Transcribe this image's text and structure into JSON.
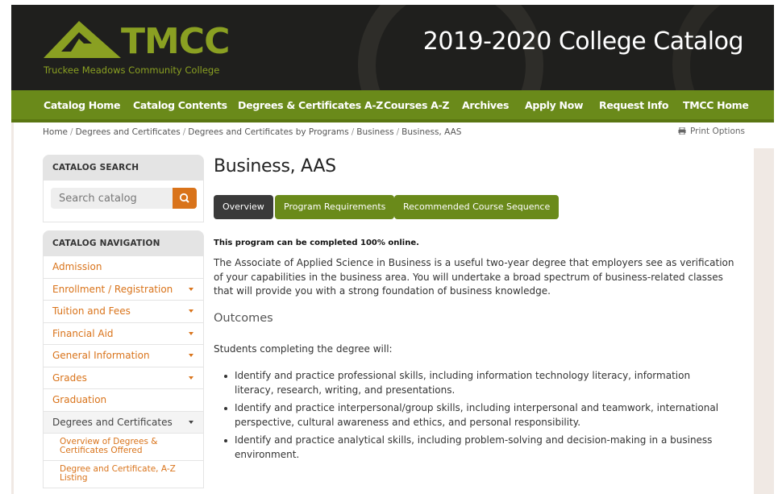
{
  "header": {
    "logo_text": "TMCC",
    "logo_subtitle": "Truckee Meadows Community College",
    "site_title": "2019-2020 College Catalog"
  },
  "nav": {
    "items": [
      {
        "label": "Catalog Home"
      },
      {
        "label": "Catalog Contents"
      },
      {
        "label": "Degrees & Certificates A-Z"
      },
      {
        "label": "Courses A-Z"
      },
      {
        "label": "Archives"
      },
      {
        "label": "Apply Now"
      },
      {
        "label": "Request Info"
      },
      {
        "label": "TMCC Home"
      }
    ]
  },
  "breadcrumb": {
    "items": [
      "Home",
      "Degrees and Certificates",
      "Degrees and Certificates by Programs",
      "Business",
      "Business, AAS"
    ],
    "separator": "/"
  },
  "print_options": "Print Options",
  "sidebar": {
    "search_title": "CATALOG SEARCH",
    "search_placeholder": "Search catalog",
    "nav_title": "CATALOG NAVIGATION",
    "items": [
      {
        "label": "Admission",
        "has_caret": false
      },
      {
        "label": "Enrollment / Registration",
        "has_caret": true
      },
      {
        "label": "Tuition and Fees",
        "has_caret": true
      },
      {
        "label": "Financial Aid",
        "has_caret": true
      },
      {
        "label": "General Information",
        "has_caret": true
      },
      {
        "label": "Grades",
        "has_caret": true
      },
      {
        "label": "Graduation",
        "has_caret": false
      },
      {
        "label": "Degrees and Certificates",
        "has_caret": true,
        "open": true
      }
    ],
    "subitems": [
      {
        "label": "Overview of Degrees & Certificates Offered"
      },
      {
        "label": "Degree and Certificate, A-Z Listing"
      }
    ]
  },
  "main": {
    "title": "Business, AAS",
    "tabs": [
      {
        "label": "Overview",
        "active": true
      },
      {
        "label": "Program Requirements",
        "active": false
      },
      {
        "label": "Recommended Course Sequence",
        "active": false
      }
    ],
    "online_note": "This program can be completed 100% online.",
    "description": "The Associate of Applied Science in Business is a useful two-year degree that employers see as verification of your capabilities in the business area. You will undertake a broad spectrum of business-related classes that will provide you with a strong foundation of business knowledge.",
    "outcomes_heading": "Outcomes",
    "outcomes_lead": "Students completing the degree will:",
    "outcomes": [
      "Identify and practice professional skills, including information technology literacy, information literacy, research, writing, and presentations.",
      "Identify and practice interpersonal/group skills, including interpersonal and teamwork, international perspective, cultural awareness and ethics, and personal responsibility.",
      "Identify and practice analytical skills, including problem-solving and decision-making in a business environment."
    ]
  },
  "colors": {
    "header_bg": "#1f1f1d",
    "nav_green": "#6a8a1a",
    "accent_orange": "#d9731a",
    "logo_green": "#8aa022",
    "tab_active": "#3a3a3a"
  },
  "icons": {
    "search": "search-icon",
    "print": "print-icon",
    "caret": "chevron-down-icon"
  }
}
